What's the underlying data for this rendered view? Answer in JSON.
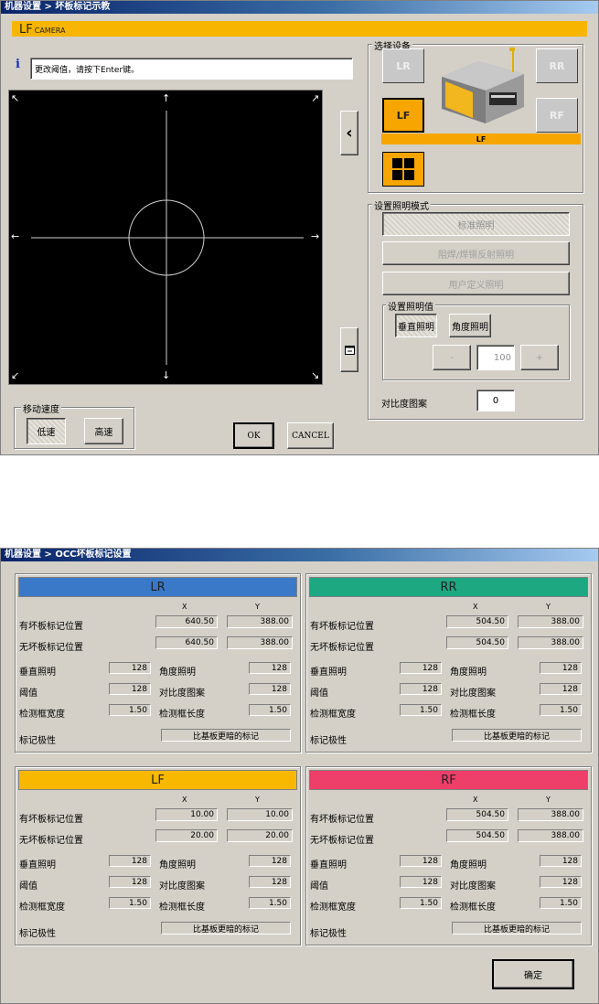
{
  "top": {
    "title": "机器设置 > 坏板标记示教",
    "camera_label": "LF",
    "camera_sub": "CAMERA",
    "info_icon": "info-icon",
    "info_text": "更改阈值，请按下Enter键。",
    "arrows": {
      "nw": "↖",
      "n": "↑",
      "ne": "↗",
      "w": "←",
      "e": "→",
      "sw": "↙",
      "s": "↓",
      "se": "↘"
    },
    "move_speed": {
      "title": "移动速度",
      "low": "低速",
      "high": "高速"
    },
    "ok": "OK",
    "cancel": "CANCEL",
    "side_left": "‹",
    "device": {
      "title": "选择设备",
      "lr": "LR",
      "rr": "RR",
      "lf": "LF",
      "rf": "RF",
      "selected_label": "LF"
    },
    "lighting": {
      "title": "设置照明模式",
      "standard": "标准照明",
      "solder": "阻焊/焊锡反射照明",
      "user": "用户定义照明",
      "value_title": "设置照明值",
      "vertical": "垂直照明",
      "angle": "角度照明",
      "minus": "-",
      "plus": "+",
      "value": "100",
      "contrast_label": "对比度图案",
      "contrast_value": "0"
    },
    "colors": {
      "accent": "#f7b500",
      "viewer": "#000000"
    }
  },
  "bottom": {
    "title": "机器设置 > OCC坏板标记设置",
    "col_x": "X",
    "col_y": "Y",
    "labels": {
      "has_pos": "有坏板标记位置",
      "no_pos": "无坏板标记位置",
      "vertical": "垂直照明",
      "angle": "角度照明",
      "threshold": "阈值",
      "contrast": "对比度图案",
      "width": "检测框宽度",
      "length": "检测框长度",
      "polarity": "标记极性"
    },
    "panels": [
      {
        "name": "LR",
        "color": "#3a78c8",
        "has_x": "640.50",
        "has_y": "388.00",
        "no_x": "640.50",
        "no_y": "388.00",
        "vertical": "128",
        "angle": "128",
        "threshold": "128",
        "contrast": "128",
        "width": "1.50",
        "length": "1.50",
        "polarity": "比基板更暗的标记"
      },
      {
        "name": "RR",
        "color": "#1ea882",
        "has_x": "504.50",
        "has_y": "388.00",
        "no_x": "504.50",
        "no_y": "388.00",
        "vertical": "128",
        "angle": "128",
        "threshold": "128",
        "contrast": "128",
        "width": "1.50",
        "length": "1.50",
        "polarity": "比基板更暗的标记"
      },
      {
        "name": "LF",
        "color": "#f8b800",
        "has_x": "10.00",
        "has_y": "10.00",
        "no_x": "20.00",
        "no_y": "20.00",
        "vertical": "128",
        "angle": "128",
        "threshold": "128",
        "contrast": "128",
        "width": "1.50",
        "length": "1.50",
        "polarity": "比基板更暗的标记"
      },
      {
        "name": "RF",
        "color": "#ee3e6a",
        "has_x": "504.50",
        "has_y": "388.00",
        "no_x": "504.50",
        "no_y": "388.00",
        "vertical": "128",
        "angle": "128",
        "threshold": "128",
        "contrast": "128",
        "width": "1.50",
        "length": "1.50",
        "polarity": "比基板更暗的标记"
      }
    ],
    "confirm": "确定"
  }
}
